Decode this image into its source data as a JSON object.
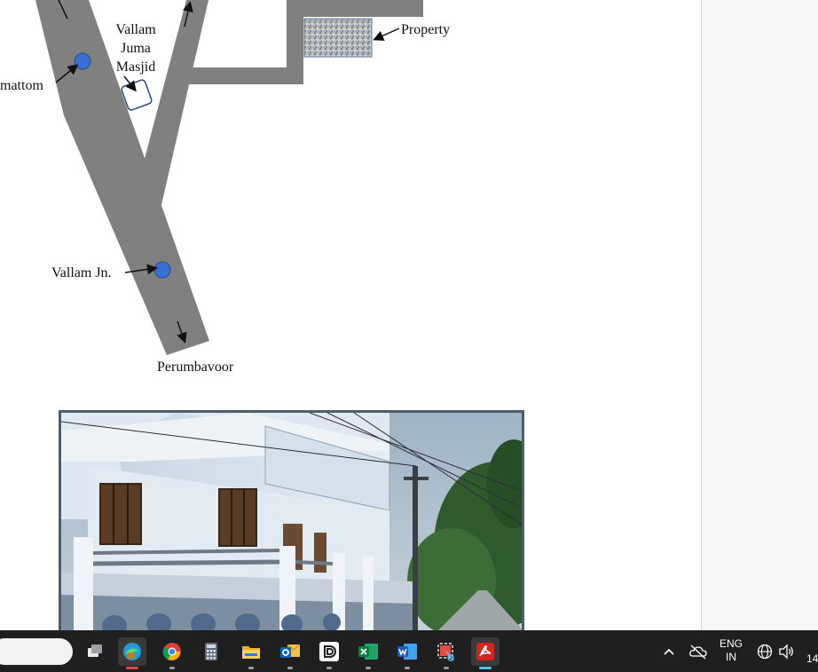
{
  "map": {
    "labels": {
      "mosque": [
        "Vallam",
        "Juma",
        "Masjid"
      ],
      "property": "Property",
      "left_place": "mattom",
      "junction": "Vallam Jn.",
      "bottom_place": "Perumbavoor"
    },
    "colors": {
      "road": "#808080",
      "marker": "#3b6fd4",
      "marker_stroke": "#2a4a8a"
    }
  },
  "photo": {
    "subject": "two-storey white house beside a lane with electric poles"
  },
  "taskbar": {
    "apps": [
      {
        "name": "task-view-icon"
      },
      {
        "name": "edge-icon",
        "active": true
      },
      {
        "name": "chrome-icon"
      },
      {
        "name": "calculator-icon"
      },
      {
        "name": "file-explorer-icon"
      },
      {
        "name": "outlook-icon"
      },
      {
        "name": "dolby-icon"
      },
      {
        "name": "excel-icon"
      },
      {
        "name": "word-icon"
      },
      {
        "name": "snipping-tool-icon"
      },
      {
        "name": "acrobat-icon",
        "active": true
      }
    ],
    "tray": {
      "lang_line1": "ENG",
      "lang_line2": "IN",
      "clock": "14"
    }
  }
}
